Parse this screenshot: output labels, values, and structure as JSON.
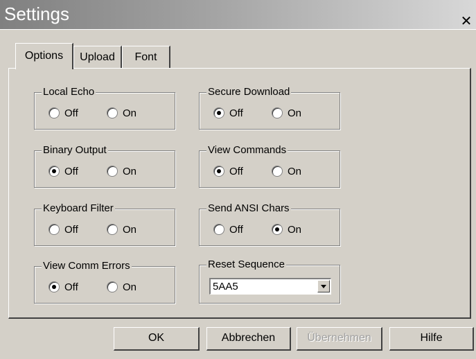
{
  "window": {
    "title": "Settings",
    "close_label": "✕"
  },
  "tabs": [
    {
      "label": "Options",
      "active": true
    },
    {
      "label": "Upload",
      "active": false
    },
    {
      "label": "Font",
      "active": false
    }
  ],
  "options": {
    "local_echo": {
      "label": "Local Echo",
      "off": "Off",
      "on": "On",
      "selected": "off_none"
    },
    "binary_output": {
      "label": "Binary Output",
      "off": "Off",
      "on": "On",
      "selected": "off"
    },
    "keyboard_filter": {
      "label": "Keyboard Filter",
      "off": "Off",
      "on": "On",
      "selected": "none"
    },
    "view_comm_errors": {
      "label": "View Comm Errors",
      "off": "Off",
      "on": "On",
      "selected": "off"
    },
    "secure_download": {
      "label": "Secure Download",
      "off": "Off",
      "on": "On",
      "selected": "off"
    },
    "view_commands": {
      "label": "View Commands",
      "off": "Off",
      "on": "On",
      "selected": "off"
    },
    "send_ansi_chars": {
      "label": "Send ANSI Chars",
      "off": "Off",
      "on": "On",
      "selected": "on"
    },
    "reset_sequence": {
      "label": "Reset Sequence",
      "value": "5AA5"
    }
  },
  "buttons": {
    "ok": "OK",
    "cancel": "Abbrechen",
    "apply": "Übernehmen",
    "help": "Hilfe"
  }
}
